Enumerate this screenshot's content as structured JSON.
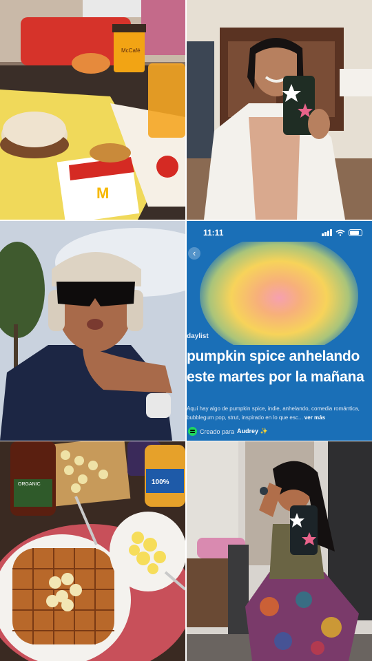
{
  "collage": {
    "tiles": [
      {
        "name": "mcdonalds-breakfast-photo",
        "text": {
          "cup_brand": "McCafé",
          "wrapper_logo": "M"
        }
      },
      {
        "name": "mirror-selfie-white-shirt"
      },
      {
        "name": "outdoor-selfie-headphones"
      },
      {
        "name": "spotify-daylist-screenshot"
      },
      {
        "name": "waffle-breakfast-photo",
        "text": {
          "jar_label_1": "ORGANIC",
          "jar_label_2": "100%"
        }
      },
      {
        "name": "mirror-selfie-patterned-pants"
      }
    ]
  },
  "spotify": {
    "status_time": "11:11",
    "section_label": "daylist",
    "title_line1": "pumpkin spice anhelando",
    "title_line2": "este martes por la mañana",
    "description": "Aquí hay algo de pumpkin spice, indie, anhelando, comedia romántica, bubblegum pop, strut, inspirado en lo que esc...",
    "more_link": "ver más",
    "created_for_prefix": "Creado para",
    "created_for_name": "Audrey ✨",
    "back_icon": "chevron-left-icon",
    "colors": {
      "background": "#1a6fb7",
      "orb_center": "#f6a0b0",
      "orb_mid": "#f7d35a"
    }
  }
}
